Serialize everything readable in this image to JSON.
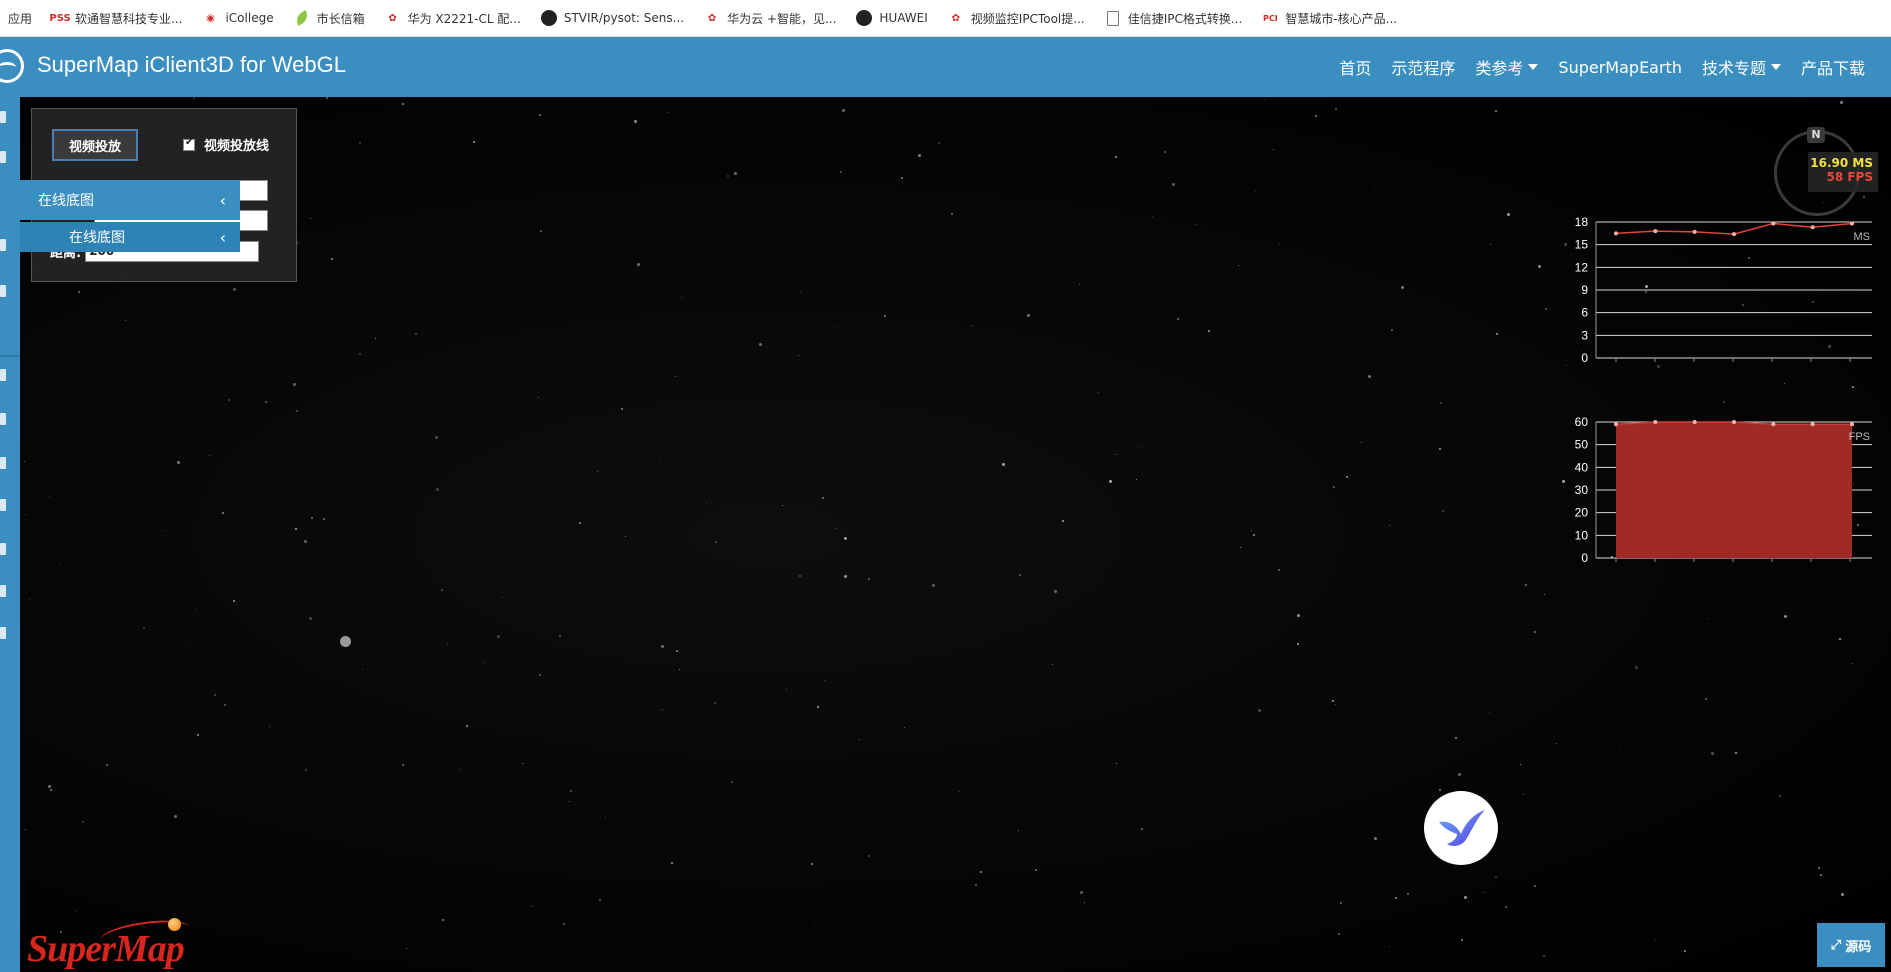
{
  "bookmarks": [
    {
      "label": "应用",
      "icon": "apps-icon"
    },
    {
      "label": "软通智慧科技专业...",
      "icon": "pss-logo-icon"
    },
    {
      "label": "iCollege",
      "icon": "icollege-icon"
    },
    {
      "label": "市长信箱",
      "icon": "leaf-icon"
    },
    {
      "label": "华为 X2221-CL 配...",
      "icon": "huawei-icon"
    },
    {
      "label": "STVIR/pysot: Sens...",
      "icon": "github-icon"
    },
    {
      "label": "华为云 +智能，见...",
      "icon": "huawei-icon"
    },
    {
      "label": "HUAWEI",
      "icon": "github-icon"
    },
    {
      "label": "视频监控IPCTool提...",
      "icon": "huawei-icon"
    },
    {
      "label": "佳信捷IPC格式转换...",
      "icon": "document-icon"
    },
    {
      "label": "智慧城市-核心产品...",
      "icon": "pci-icon"
    }
  ],
  "header": {
    "title": "SuperMap iClient3D for WebGL",
    "nav": [
      {
        "label": "首页",
        "has_caret": false
      },
      {
        "label": "示范程序",
        "has_caret": false
      },
      {
        "label": "类参考",
        "has_caret": true
      },
      {
        "label": "SuperMapEarth",
        "has_caret": false
      },
      {
        "label": "技术专题",
        "has_caret": true
      },
      {
        "label": "产品下载",
        "has_caret": false
      }
    ]
  },
  "flyout": {
    "item1": "在线底图",
    "item2": "在线底图"
  },
  "panel": {
    "project_button": "视频投放",
    "checkbox_label": "视频投放线",
    "checkbox_checked": true,
    "distance_label": "距离:",
    "distance_value": "200"
  },
  "stats": {
    "ms": "16.90 MS",
    "fps": "58 FPS",
    "compass_label": "N"
  },
  "chart_data": [
    {
      "type": "line",
      "series_label": "MS",
      "y_ticks": [
        0,
        3,
        6,
        9,
        12,
        15,
        18
      ],
      "ylim": [
        0,
        18
      ],
      "values": [
        16.5,
        16.8,
        16.7,
        16.4,
        17.8,
        17.3,
        17.8
      ],
      "color": "#e0443a"
    },
    {
      "type": "area",
      "series_label": "FPS",
      "y_ticks": [
        0,
        10,
        20,
        30,
        40,
        50,
        60
      ],
      "ylim": [
        0,
        60
      ],
      "values": [
        59,
        60,
        60,
        60,
        59,
        59,
        59
      ],
      "color": "#a22a25"
    }
  ],
  "footer": {
    "logo_text": "SuperMap",
    "source_button": "源码"
  },
  "colors": {
    "header_blue": "#3a8fc0",
    "brand_red": "#d6261d"
  }
}
